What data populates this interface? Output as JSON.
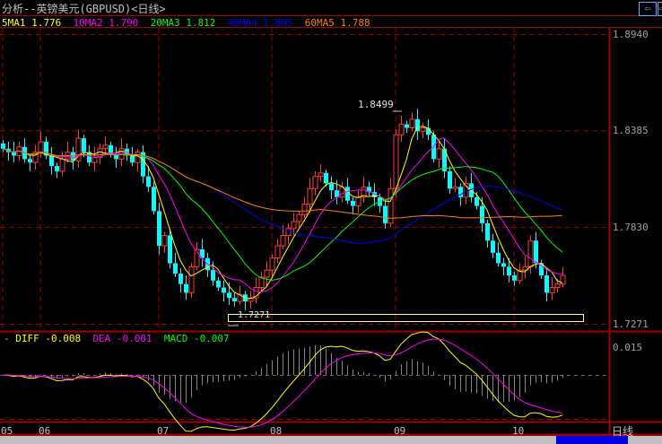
{
  "window": {
    "title": "分析--英镑美元(GBPUSD)<日线>",
    "period_label": "日线"
  },
  "legend": [
    {
      "name": "5MA1",
      "value": "1.776",
      "color": "#ffff00"
    },
    {
      "name": "10MA2",
      "value": "1.790",
      "color": "#ff00ff"
    },
    {
      "name": "20MA3",
      "value": "1.812",
      "color": "#00ff00"
    },
    {
      "name": "40MA4",
      "value": "1.805",
      "color": "#0000ff"
    },
    {
      "name": "60MA5",
      "value": "1.788",
      "color": "#ff8000"
    }
  ],
  "macd_legend": [
    {
      "name": "DIFF",
      "value": "-0.008",
      "color": "#ffff00"
    },
    {
      "name": "DEA",
      "value": "-0.001",
      "color": "#ff00ff"
    },
    {
      "name": "MACD",
      "value": "-0.007",
      "color": "#00ff00"
    }
  ],
  "annotations": {
    "high": "1.8499",
    "low": "1.7271"
  },
  "chart_data": {
    "type": "candlestick",
    "symbol": "GBPUSD",
    "y_ticks": [
      "1.8940",
      "1.8385",
      "1.7830",
      "1.7271"
    ],
    "ylim": [
      1.7271,
      1.894
    ],
    "macd_ticks": [
      "0.015"
    ],
    "x_ticks": [
      {
        "label": "05",
        "bar": 0
      },
      {
        "label": "06",
        "bar": 7
      },
      {
        "label": "07",
        "bar": 29
      },
      {
        "label": "08",
        "bar": 50
      },
      {
        "label": "09",
        "bar": 73
      },
      {
        "label": "10",
        "bar": 95
      }
    ],
    "ma_periods": [
      5,
      10,
      20,
      40,
      60
    ],
    "closes": [
      1.828,
      1.826,
      1.824,
      1.829,
      1.822,
      1.82,
      1.826,
      1.832,
      1.824,
      1.818,
      1.815,
      1.822,
      1.826,
      1.821,
      1.834,
      1.826,
      1.82,
      1.823,
      1.828,
      1.83,
      1.825,
      1.822,
      1.828,
      1.824,
      1.82,
      1.826,
      1.812,
      1.806,
      1.792,
      1.772,
      1.778,
      1.762,
      1.756,
      1.75,
      1.745,
      1.76,
      1.77,
      1.765,
      1.758,
      1.752,
      1.748,
      1.745,
      1.742,
      1.74,
      1.744,
      1.74,
      1.742,
      1.748,
      1.754,
      1.758,
      1.765,
      1.772,
      1.778,
      1.782,
      1.786,
      1.79,
      1.796,
      1.805,
      1.812,
      1.814,
      1.808,
      1.804,
      1.8,
      1.806,
      1.798,
      1.795,
      1.8,
      1.806,
      1.803,
      1.8,
      1.795,
      1.785,
      1.805,
      1.836,
      1.842,
      1.84,
      1.845,
      1.838,
      1.84,
      1.836,
      1.822,
      1.828,
      1.815,
      1.805,
      1.806,
      1.8,
      1.808,
      1.8,
      1.795,
      1.785,
      1.775,
      1.768,
      1.762,
      1.76,
      1.755,
      1.752,
      1.758,
      1.76,
      1.775,
      1.762,
      1.755,
      1.745,
      1.748,
      1.75,
      1.755
    ]
  }
}
